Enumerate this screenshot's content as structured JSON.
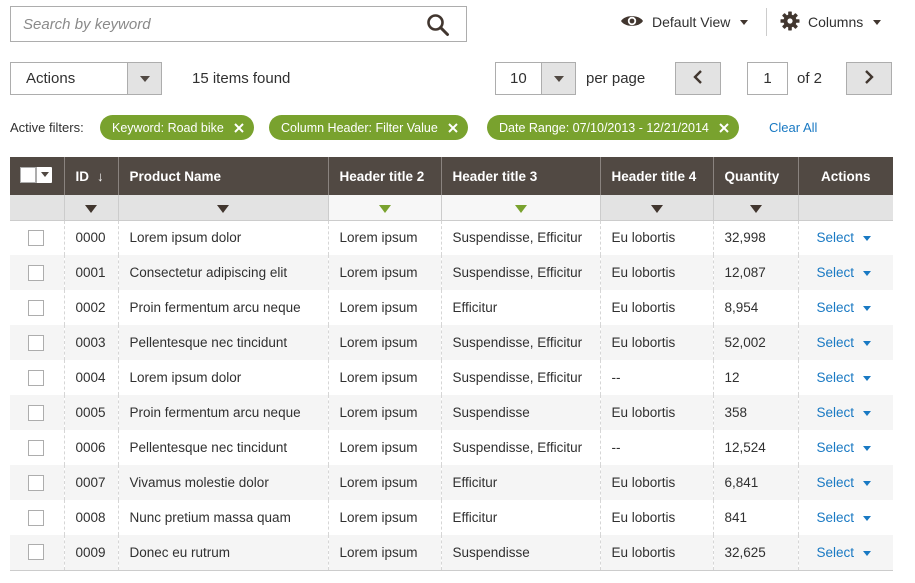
{
  "search": {
    "placeholder": "Search by keyword",
    "value": ""
  },
  "view": {
    "label": "Default View",
    "icon": "eye-icon"
  },
  "columns": {
    "label": "Columns",
    "icon": "gear-icon"
  },
  "actions": {
    "selected": "Actions"
  },
  "items_found": "15 items found",
  "pagination": {
    "per_page_value": "10",
    "per_page_label": "per page",
    "current_page": "1",
    "of_label": "of 2"
  },
  "filters": {
    "label": "Active filters:",
    "chips": [
      "Keyword: Road bike",
      "Column Header: Filter Value",
      "Date Range: 07/10/2013 - 12/21/2014"
    ],
    "clear_all": "Clear All"
  },
  "colors": {
    "header_bg": "#514943",
    "accent_green": "#79a22e",
    "link_blue": "#1979c3"
  },
  "table": {
    "headers": {
      "id": "ID",
      "id_sort": "↓",
      "name": "Product Name",
      "h2": "Header title 2",
      "h3": "Header title 3",
      "h4": "Header title 4",
      "qty": "Quantity",
      "actions": "Actions"
    },
    "action_label": "Select",
    "rows": [
      {
        "id": "0000",
        "name": "Lorem ipsum dolor",
        "h2": "Lorem ipsum",
        "h3": "Suspendisse, Efficitur",
        "h4": "Eu lobortis",
        "qty": "32,998"
      },
      {
        "id": "0001",
        "name": "Consectetur adipiscing elit",
        "h2": "Lorem ipsum",
        "h3": "Suspendisse, Efficitur",
        "h4": "Eu lobortis",
        "qty": "12,087"
      },
      {
        "id": "0002",
        "name": "Proin fermentum arcu neque",
        "h2": "Lorem ipsum",
        "h3": "Efficitur",
        "h4": "Eu lobortis",
        "qty": "8,954"
      },
      {
        "id": "0003",
        "name": "Pellentesque nec tincidunt",
        "h2": "Lorem ipsum",
        "h3": "Suspendisse, Efficitur",
        "h4": "Eu lobortis",
        "qty": "52,002"
      },
      {
        "id": "0004",
        "name": "Lorem ipsum dolor",
        "h2": "Lorem ipsum",
        "h3": "Suspendisse, Efficitur",
        "h4": "--",
        "qty": "12"
      },
      {
        "id": "0005",
        "name": "Proin fermentum arcu neque",
        "h2": "Lorem ipsum",
        "h3": "Suspendisse",
        "h4": "Eu lobortis",
        "qty": "358"
      },
      {
        "id": "0006",
        "name": "Pellentesque nec tincidunt",
        "h2": "Lorem ipsum",
        "h3": "Suspendisse, Efficitur",
        "h4": "--",
        "qty": "12,524"
      },
      {
        "id": "0007",
        "name": "Vivamus molestie dolor",
        "h2": "Lorem ipsum",
        "h3": "Efficitur",
        "h4": "Eu lobortis",
        "qty": "6,841"
      },
      {
        "id": "0008",
        "name": "Nunc pretium massa quam",
        "h2": "Lorem ipsum",
        "h3": "Efficitur",
        "h4": "Eu lobortis",
        "qty": "841"
      },
      {
        "id": "0009",
        "name": "Donec eu rutrum",
        "h2": "Lorem ipsum",
        "h3": "Suspendisse",
        "h4": "Eu lobortis",
        "qty": "32,625"
      }
    ]
  }
}
